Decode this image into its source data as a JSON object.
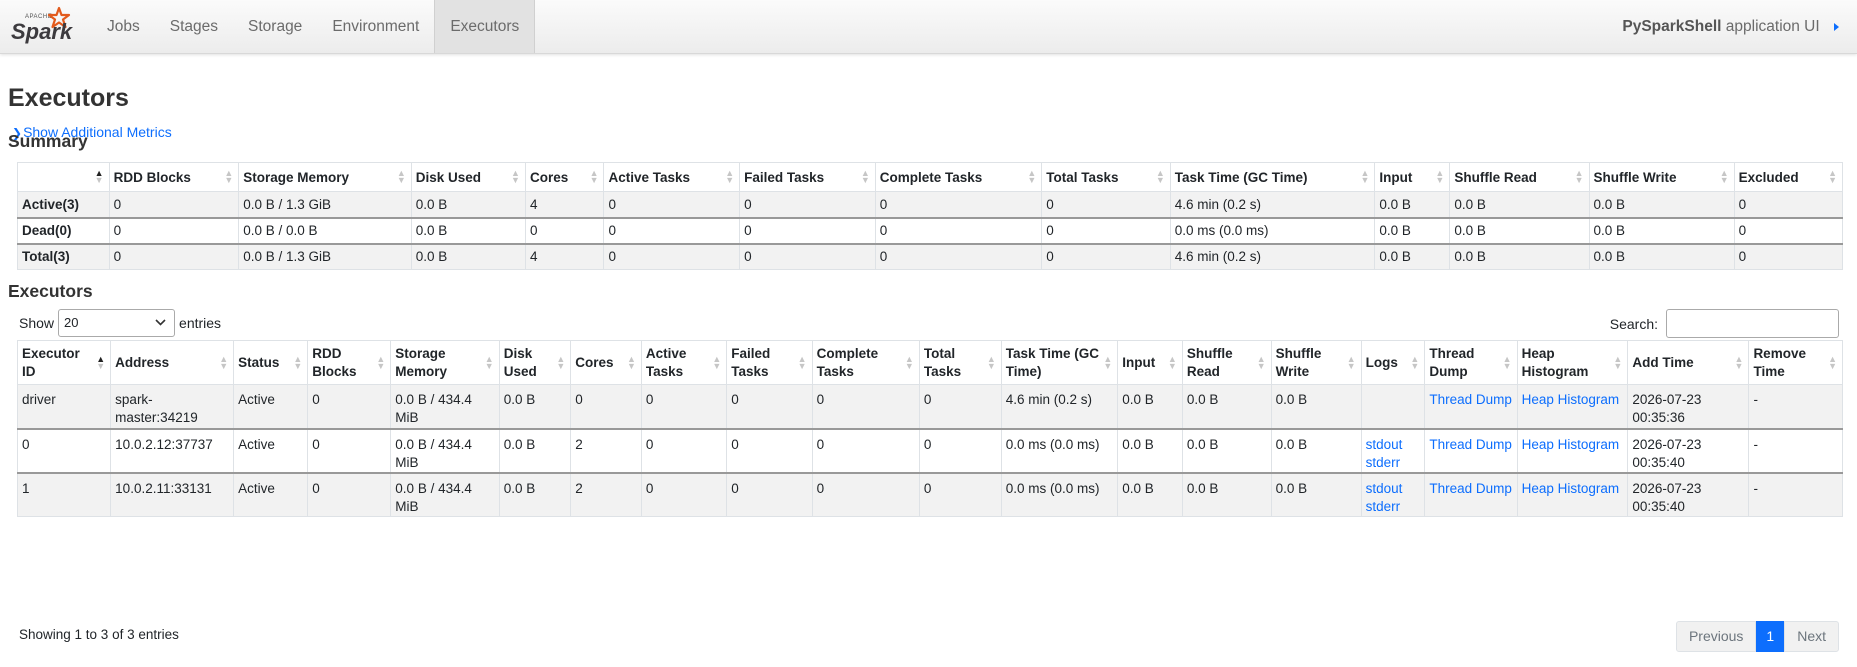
{
  "navbar": {
    "brand_small": "APACHE",
    "brand_text": "Spark",
    "items": [
      {
        "label": "Jobs",
        "active": false
      },
      {
        "label": "Stages",
        "active": false
      },
      {
        "label": "Storage",
        "active": false
      },
      {
        "label": "Environment",
        "active": false
      },
      {
        "label": "Executors",
        "active": true
      }
    ],
    "app_name": "PySparkShell",
    "app_suffix": "application UI"
  },
  "page": {
    "title": "Executors",
    "show_additional_metrics": "Show Additional Metrics"
  },
  "summary": {
    "title": "Summary",
    "columns": [
      "",
      "RDD Blocks",
      "Storage Memory",
      "Disk Used",
      "Cores",
      "Active Tasks",
      "Failed Tasks",
      "Complete Tasks",
      "Total Tasks",
      "Task Time (GC Time)",
      "Input",
      "Shuffle Read",
      "Shuffle Write",
      "Excluded"
    ],
    "rows": [
      [
        "Active(3)",
        "0",
        "0.0 B / 1.3 GiB",
        "0.0 B",
        "4",
        "0",
        "0",
        "0",
        "0",
        "4.6 min (0.2 s)",
        "0.0 B",
        "0.0 B",
        "0.0 B",
        "0"
      ],
      [
        "Dead(0)",
        "0",
        "0.0 B / 0.0 B",
        "0.0 B",
        "0",
        "0",
        "0",
        "0",
        "0",
        "0.0 ms (0.0 ms)",
        "0.0 B",
        "0.0 B",
        "0.0 B",
        "0"
      ],
      [
        "Total(3)",
        "0",
        "0.0 B / 1.3 GiB",
        "0.0 B",
        "4",
        "0",
        "0",
        "0",
        "0",
        "4.6 min (0.2 s)",
        "0.0 B",
        "0.0 B",
        "0.0 B",
        "0"
      ]
    ]
  },
  "executors": {
    "title": "Executors",
    "show_label": "Show",
    "entries_label": "entries",
    "page_length": "20",
    "search_label": "Search:",
    "search_value": "",
    "columns": [
      "Executor ID",
      "Address",
      "Status",
      "RDD Blocks",
      "Storage Memory",
      "Disk Used",
      "Cores",
      "Active Tasks",
      "Failed Tasks",
      "Complete Tasks",
      "Total Tasks",
      "Task Time (GC Time)",
      "Input",
      "Shuffle Read",
      "Shuffle Write",
      "Logs",
      "Thread Dump",
      "Heap Histogram",
      "Add Time",
      "Remove Time"
    ],
    "rows": [
      {
        "id": "driver",
        "address": "spark-master:34219",
        "status": "Active",
        "rdd_blocks": "0",
        "storage_memory": "0.0 B / 434.4 MiB",
        "disk_used": "0.0 B",
        "cores": "0",
        "active_tasks": "0",
        "failed_tasks": "0",
        "complete_tasks": "0",
        "total_tasks": "0",
        "task_time": "4.6 min (0.2 s)",
        "input": "0.0 B",
        "shuffle_read": "0.0 B",
        "shuffle_write": "0.0 B",
        "logs": [],
        "thread_dump": "Thread Dump",
        "heap_histogram": "Heap Histogram",
        "add_time": "2026-07-23 00:35:36",
        "remove_time": "-"
      },
      {
        "id": "0",
        "address": "10.0.2.12:37737",
        "status": "Active",
        "rdd_blocks": "0",
        "storage_memory": "0.0 B / 434.4 MiB",
        "disk_used": "0.0 B",
        "cores": "2",
        "active_tasks": "0",
        "failed_tasks": "0",
        "complete_tasks": "0",
        "total_tasks": "0",
        "task_time": "0.0 ms (0.0 ms)",
        "input": "0.0 B",
        "shuffle_read": "0.0 B",
        "shuffle_write": "0.0 B",
        "logs": [
          "stdout",
          "stderr"
        ],
        "thread_dump": "Thread Dump",
        "heap_histogram": "Heap Histogram",
        "add_time": "2026-07-23 00:35:40",
        "remove_time": "-"
      },
      {
        "id": "1",
        "address": "10.0.2.11:33131",
        "status": "Active",
        "rdd_blocks": "0",
        "storage_memory": "0.0 B / 434.4 MiB",
        "disk_used": "0.0 B",
        "cores": "2",
        "active_tasks": "0",
        "failed_tasks": "0",
        "complete_tasks": "0",
        "total_tasks": "0",
        "task_time": "0.0 ms (0.0 ms)",
        "input": "0.0 B",
        "shuffle_read": "0.0 B",
        "shuffle_write": "0.0 B",
        "logs": [
          "stdout",
          "stderr"
        ],
        "thread_dump": "Thread Dump",
        "heap_histogram": "Heap Histogram",
        "add_time": "2026-07-23 00:35:40",
        "remove_time": "-"
      }
    ],
    "info": "Showing 1 to 3 of 3 entries",
    "pagination": {
      "previous": "Previous",
      "current": "1",
      "next": "Next"
    }
  },
  "colors": {
    "link": "#0d6efd",
    "spark_orange": "#e25a1c",
    "row_stripe": "#f2f2f2"
  },
  "icons": {
    "brand": "spark-logo-star",
    "sort": "sort-arrows-icon",
    "select": "chevron-down-icon",
    "expand": "chevron-right-icon"
  }
}
